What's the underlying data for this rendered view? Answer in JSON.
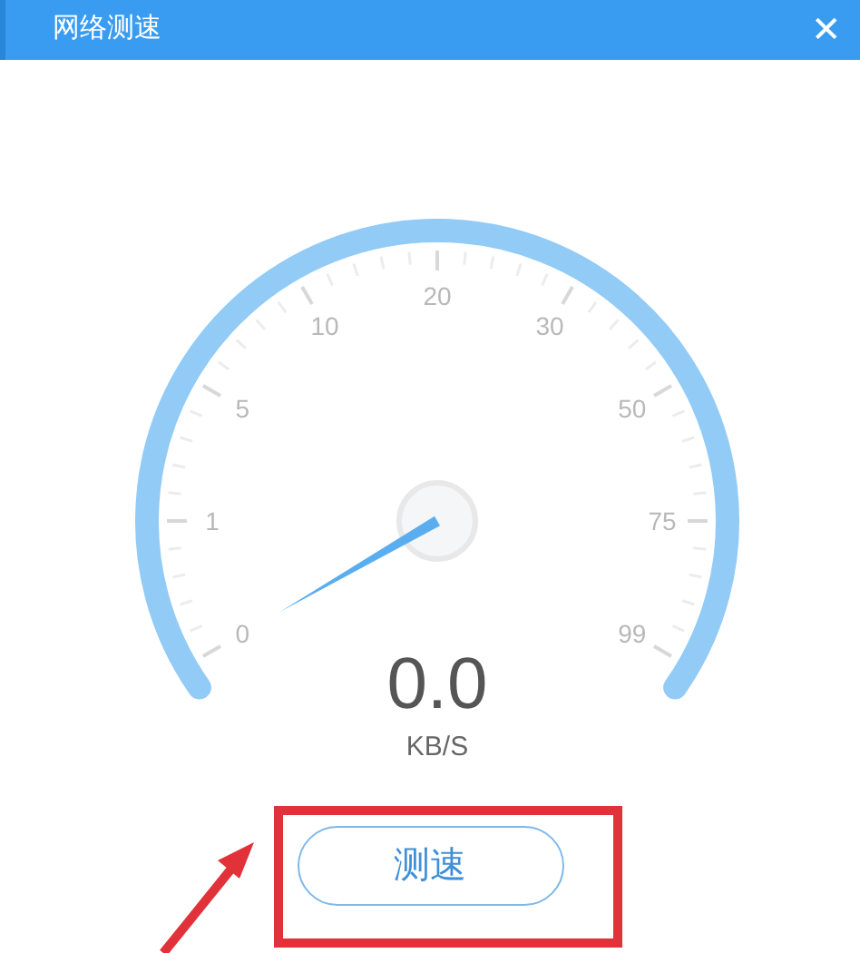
{
  "window": {
    "title": "网络测速",
    "close": "✕"
  },
  "gauge": {
    "labels": [
      "0",
      "1",
      "5",
      "10",
      "20",
      "30",
      "50",
      "75",
      "99"
    ],
    "value": "0.0",
    "unit": "KB/S"
  },
  "button": {
    "label": "测速"
  }
}
